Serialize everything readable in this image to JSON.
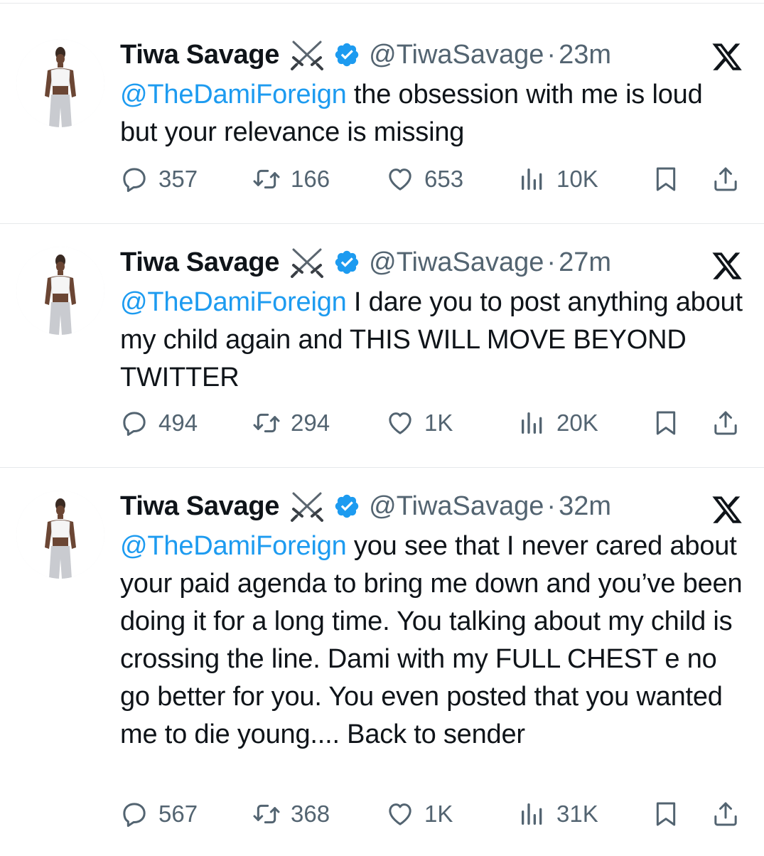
{
  "tweets": [
    {
      "name": "Tiwa Savage",
      "handle": "@TiwaSavage",
      "separator": "·",
      "time": "23m",
      "mention": "@TheDamiForeign",
      "text": " the obsession with me is loud but your relevance is missing",
      "replies": "357",
      "retweets": "166",
      "likes": "653",
      "views": "10K"
    },
    {
      "name": "Tiwa Savage",
      "handle": "@TiwaSavage",
      "separator": "·",
      "time": "27m",
      "mention": "@TheDamiForeign",
      "text": " I dare you to post anything about my child again and THIS WILL MOVE BEYOND TWITTER",
      "replies": "494",
      "retweets": "294",
      "likes": "1K",
      "views": "20K"
    },
    {
      "name": "Tiwa Savage",
      "handle": "@TiwaSavage",
      "separator": "·",
      "time": "32m",
      "mention": "@TheDamiForeign",
      "text": " you see that I never cared about your paid agenda to bring me down and you’ve been doing it for a long time. You talking about my child is crossing the line. Dami with my FULL CHEST e no go better for you. You even posted that you wanted me to die young.... Back to sender",
      "replies": "567",
      "retweets": "368",
      "likes": "1K",
      "views": "31K"
    }
  ],
  "icons": {
    "name_emoji": "crossed-swords-icon",
    "verified": "verified-badge-icon",
    "platform": "x-logo-icon",
    "reply": "reply-icon",
    "retweet": "retweet-icon",
    "like": "heart-icon",
    "views": "views-icon",
    "bookmark": "bookmark-icon",
    "share": "share-icon"
  },
  "colors": {
    "mention": "#1d9bf0",
    "verified": "#1d9bf0",
    "secondary_text": "#536471",
    "primary_text": "#0f1419"
  }
}
